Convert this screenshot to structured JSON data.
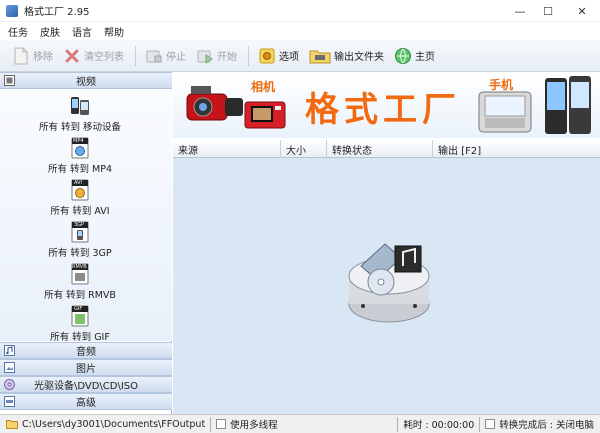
{
  "window": {
    "title": "格式工厂 2.95",
    "minimize": "—",
    "maximize": "☐",
    "close": "✕"
  },
  "menu": [
    "任务",
    "皮肤",
    "语言",
    "帮助"
  ],
  "toolbar": {
    "remove": "移除",
    "clear": "清空列表",
    "stop": "停止",
    "start": "开始",
    "options": "选项",
    "output_folder": "输出文件夹",
    "home": "主页"
  },
  "sidebar": {
    "video": "视频",
    "audio": "音频",
    "picture": "图片",
    "optical": "光驱设备\\DVD\\CD\\ISO",
    "advanced": "高级",
    "items": [
      {
        "label": "所有 转到 移动设备",
        "icon": "mobile-device-icon",
        "badge": ""
      },
      {
        "label": "所有 转到 MP4",
        "icon": "mp4-file-icon",
        "badge": "MP4"
      },
      {
        "label": "所有 转到 AVI",
        "icon": "avi-file-icon",
        "badge": "AVI"
      },
      {
        "label": "所有 转到 3GP",
        "icon": "3gp-file-icon",
        "badge": "3GP"
      },
      {
        "label": "所有 转到 RMVB",
        "icon": "rmvb-file-icon",
        "badge": "RMVB"
      },
      {
        "label": "所有 转到 GIF",
        "icon": "gif-file-icon",
        "badge": "GIF"
      }
    ]
  },
  "banner": {
    "title": "格式工厂",
    "camera_label": "相机",
    "phone_label": "手机"
  },
  "table": {
    "columns": [
      "来源",
      "大小",
      "转换状态",
      "输出 [F2]"
    ]
  },
  "status": {
    "output_path": "C:\\Users\\dy3001\\Documents\\FFOutput",
    "multithread": "使用多线程",
    "elapsed": "耗时 : 00:00:00",
    "after_done": "转换完成后 : 关闭电脑"
  },
  "colors": {
    "accent_orange": "#f26a0f",
    "panel_blue": "#d9e7f5"
  }
}
